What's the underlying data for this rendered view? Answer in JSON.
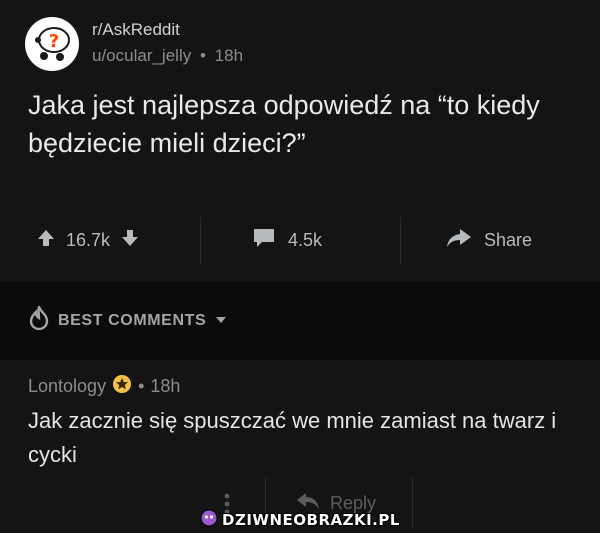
{
  "post": {
    "subreddit": "r/AskReddit",
    "author": "u/ocular_jelly",
    "separator": "•",
    "time": "18h",
    "title": "Jaka jest najlepsza odpowiedź na “to kiedy będziecie mieli dzieci?”",
    "upvotes": "16.7k",
    "comments": "4.5k",
    "share_label": "Share"
  },
  "sort": {
    "label": "BEST COMMENTS"
  },
  "comment": {
    "author": "Lontology",
    "separator": "•",
    "time": "18h",
    "body": "Jak zacznie się spuszczać we mnie zamiast na twarz i cycki",
    "reply_label": "Reply"
  },
  "watermark": {
    "text": "DZIWNEOBRAZKI.PL"
  },
  "colors": {
    "post_bg": "#141414",
    "page_bg": "#0b0b0b",
    "text_primary": "#e7e9ea",
    "text_muted": "#8a8d90",
    "award_gold": "#f5c04a"
  },
  "icons": {
    "avatar": "askreddit-snoo-icon",
    "upvote": "upvote-arrow-icon",
    "downvote": "downvote-arrow-icon",
    "comment": "comment-bubble-icon",
    "share": "share-arrow-icon",
    "sort": "flame-icon",
    "dropdown": "caret-down-icon",
    "award": "star-award-icon",
    "more": "more-vertical-icon",
    "reply": "reply-arrow-icon"
  }
}
